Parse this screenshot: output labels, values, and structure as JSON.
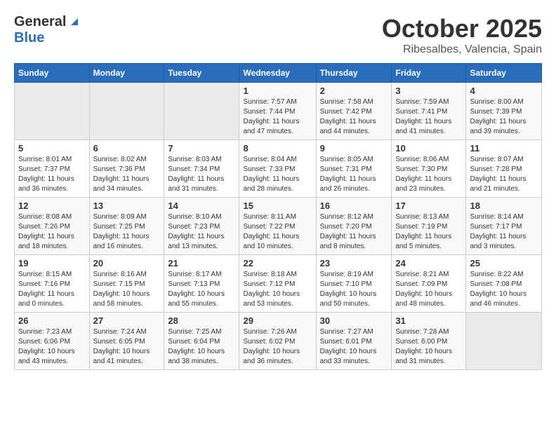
{
  "logo": {
    "general": "General",
    "blue": "Blue"
  },
  "title": "October 2025",
  "location": "Ribesalbes, Valencia, Spain",
  "weekdays": [
    "Sunday",
    "Monday",
    "Tuesday",
    "Wednesday",
    "Thursday",
    "Friday",
    "Saturday"
  ],
  "weeks": [
    [
      {
        "day": "",
        "info": ""
      },
      {
        "day": "",
        "info": ""
      },
      {
        "day": "",
        "info": ""
      },
      {
        "day": "1",
        "info": "Sunrise: 7:57 AM\nSunset: 7:44 PM\nDaylight: 11 hours and 47 minutes."
      },
      {
        "day": "2",
        "info": "Sunrise: 7:58 AM\nSunset: 7:42 PM\nDaylight: 11 hours and 44 minutes."
      },
      {
        "day": "3",
        "info": "Sunrise: 7:59 AM\nSunset: 7:41 PM\nDaylight: 11 hours and 41 minutes."
      },
      {
        "day": "4",
        "info": "Sunrise: 8:00 AM\nSunset: 7:39 PM\nDaylight: 11 hours and 39 minutes."
      }
    ],
    [
      {
        "day": "5",
        "info": "Sunrise: 8:01 AM\nSunset: 7:37 PM\nDaylight: 11 hours and 36 minutes."
      },
      {
        "day": "6",
        "info": "Sunrise: 8:02 AM\nSunset: 7:36 PM\nDaylight: 11 hours and 34 minutes."
      },
      {
        "day": "7",
        "info": "Sunrise: 8:03 AM\nSunset: 7:34 PM\nDaylight: 11 hours and 31 minutes."
      },
      {
        "day": "8",
        "info": "Sunrise: 8:04 AM\nSunset: 7:33 PM\nDaylight: 11 hours and 28 minutes."
      },
      {
        "day": "9",
        "info": "Sunrise: 8:05 AM\nSunset: 7:31 PM\nDaylight: 11 hours and 26 minutes."
      },
      {
        "day": "10",
        "info": "Sunrise: 8:06 AM\nSunset: 7:30 PM\nDaylight: 11 hours and 23 minutes."
      },
      {
        "day": "11",
        "info": "Sunrise: 8:07 AM\nSunset: 7:28 PM\nDaylight: 11 hours and 21 minutes."
      }
    ],
    [
      {
        "day": "12",
        "info": "Sunrise: 8:08 AM\nSunset: 7:26 PM\nDaylight: 11 hours and 18 minutes."
      },
      {
        "day": "13",
        "info": "Sunrise: 8:09 AM\nSunset: 7:25 PM\nDaylight: 11 hours and 16 minutes."
      },
      {
        "day": "14",
        "info": "Sunrise: 8:10 AM\nSunset: 7:23 PM\nDaylight: 11 hours and 13 minutes."
      },
      {
        "day": "15",
        "info": "Sunrise: 8:11 AM\nSunset: 7:22 PM\nDaylight: 11 hours and 10 minutes."
      },
      {
        "day": "16",
        "info": "Sunrise: 8:12 AM\nSunset: 7:20 PM\nDaylight: 11 hours and 8 minutes."
      },
      {
        "day": "17",
        "info": "Sunrise: 8:13 AM\nSunset: 7:19 PM\nDaylight: 11 hours and 5 minutes."
      },
      {
        "day": "18",
        "info": "Sunrise: 8:14 AM\nSunset: 7:17 PM\nDaylight: 11 hours and 3 minutes."
      }
    ],
    [
      {
        "day": "19",
        "info": "Sunrise: 8:15 AM\nSunset: 7:16 PM\nDaylight: 11 hours and 0 minutes."
      },
      {
        "day": "20",
        "info": "Sunrise: 8:16 AM\nSunset: 7:15 PM\nDaylight: 10 hours and 58 minutes."
      },
      {
        "day": "21",
        "info": "Sunrise: 8:17 AM\nSunset: 7:13 PM\nDaylight: 10 hours and 55 minutes."
      },
      {
        "day": "22",
        "info": "Sunrise: 8:18 AM\nSunset: 7:12 PM\nDaylight: 10 hours and 53 minutes."
      },
      {
        "day": "23",
        "info": "Sunrise: 8:19 AM\nSunset: 7:10 PM\nDaylight: 10 hours and 50 minutes."
      },
      {
        "day": "24",
        "info": "Sunrise: 8:21 AM\nSunset: 7:09 PM\nDaylight: 10 hours and 48 minutes."
      },
      {
        "day": "25",
        "info": "Sunrise: 8:22 AM\nSunset: 7:08 PM\nDaylight: 10 hours and 46 minutes."
      }
    ],
    [
      {
        "day": "26",
        "info": "Sunrise: 7:23 AM\nSunset: 6:06 PM\nDaylight: 10 hours and 43 minutes."
      },
      {
        "day": "27",
        "info": "Sunrise: 7:24 AM\nSunset: 6:05 PM\nDaylight: 10 hours and 41 minutes."
      },
      {
        "day": "28",
        "info": "Sunrise: 7:25 AM\nSunset: 6:04 PM\nDaylight: 10 hours and 38 minutes."
      },
      {
        "day": "29",
        "info": "Sunrise: 7:26 AM\nSunset: 6:02 PM\nDaylight: 10 hours and 36 minutes."
      },
      {
        "day": "30",
        "info": "Sunrise: 7:27 AM\nSunset: 6:01 PM\nDaylight: 10 hours and 33 minutes."
      },
      {
        "day": "31",
        "info": "Sunrise: 7:28 AM\nSunset: 6:00 PM\nDaylight: 10 hours and 31 minutes."
      },
      {
        "day": "",
        "info": ""
      }
    ]
  ]
}
